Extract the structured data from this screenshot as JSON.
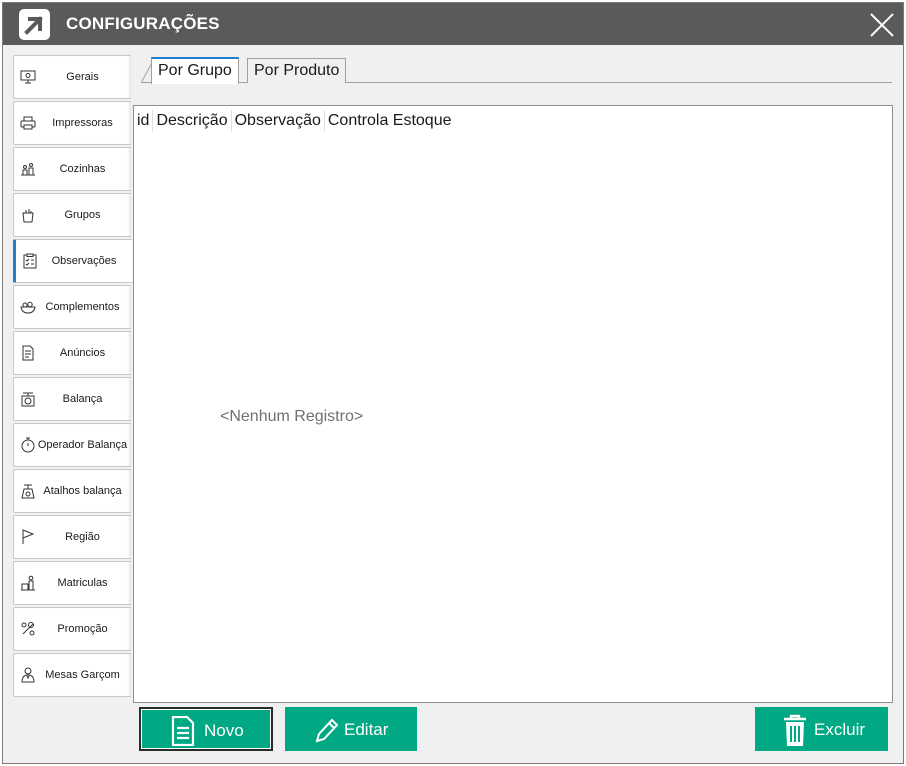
{
  "window": {
    "title": "CONFIGURAÇÕES",
    "logo_icon": "arrow-up-right-icon",
    "close_icon": "close-icon"
  },
  "sidebar": {
    "items": [
      {
        "label": "Gerais",
        "icon": "monitor-gear-icon",
        "active": false
      },
      {
        "label": "Impressoras",
        "icon": "printer-icon",
        "active": false
      },
      {
        "label": "Cozinhas",
        "icon": "kitchen-icon",
        "active": false
      },
      {
        "label": "Grupos",
        "icon": "grocery-bag-icon",
        "active": false
      },
      {
        "label": "Observações",
        "icon": "clipboard-checklist-icon",
        "active": true
      },
      {
        "label": "Complementos",
        "icon": "food-bowl-icon",
        "active": false
      },
      {
        "label": "Anúncios",
        "icon": "document-icon",
        "active": false
      },
      {
        "label": "Balança",
        "icon": "scale-icon",
        "active": false
      },
      {
        "label": "Operador  Balança",
        "icon": "stopwatch-icon",
        "active": false
      },
      {
        "label": "Atalhos balança",
        "icon": "scale-shortcut-icon",
        "active": false
      },
      {
        "label": "Região",
        "icon": "flag-icon",
        "active": false
      },
      {
        "label": "Matriculas",
        "icon": "user-registry-icon",
        "active": false
      },
      {
        "label": "Promoção",
        "icon": "promotion-icon",
        "active": false
      },
      {
        "label": "Mesas Garçom",
        "icon": "waiter-icon",
        "active": false
      }
    ]
  },
  "tabs": [
    {
      "label": "Por Grupo",
      "active": true
    },
    {
      "label": "Por Produto",
      "active": false
    }
  ],
  "grid": {
    "columns": [
      "id",
      "Descrição",
      "Observação",
      "Controla Estoque"
    ],
    "empty_message": "<Nenhum Registro>"
  },
  "actions": {
    "new_label": "Novo",
    "edit_label": "Editar",
    "delete_label": "Excluir"
  },
  "colors": {
    "titlebar": "#5a5a5a",
    "accent": "#1f7fd1",
    "button": "#00a884"
  }
}
